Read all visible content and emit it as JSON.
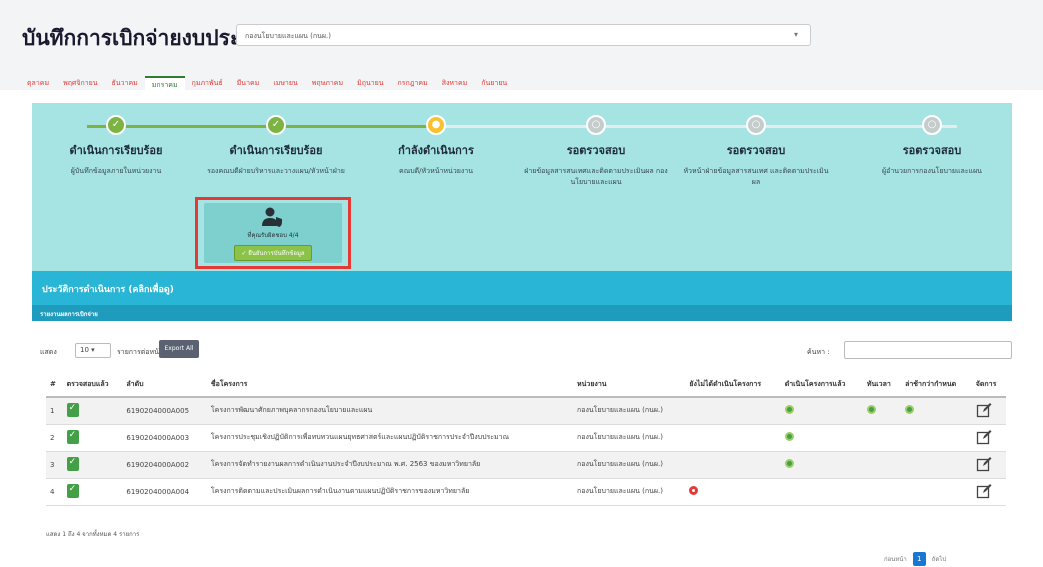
{
  "header": {
    "title": "บันทึกการเบิกจ่ายงบประมาณ",
    "department_select": "กองนโยบายและแผน (กนผ.)"
  },
  "tabs": [
    {
      "label": "ตุลาคม",
      "active": false
    },
    {
      "label": "พฤศจิกายน",
      "active": false
    },
    {
      "label": "ธันวาคม",
      "active": false
    },
    {
      "label": "มกราคม",
      "active": true
    },
    {
      "label": "กุมภาพันธ์",
      "active": false
    },
    {
      "label": "มีนาคม",
      "active": false
    },
    {
      "label": "เมษายน",
      "active": false
    },
    {
      "label": "พฤษภาคม",
      "active": false
    },
    {
      "label": "มิถุนายน",
      "active": false
    },
    {
      "label": "กรกฎาคม",
      "active": false
    },
    {
      "label": "สิงหาคม",
      "active": false
    },
    {
      "label": "กันยายน",
      "active": false
    }
  ],
  "steps": [
    {
      "title": "ดำเนินการเรียบร้อย",
      "desc": "ผู้บันทึกข้อมูลภายในหน่วยงาน",
      "status": "done"
    },
    {
      "title": "ดำเนินการเรียบร้อย",
      "desc": "รองคณบดีฝ่ายบริหารและวางแผน/หัวหน้าฝ่าย",
      "status": "done"
    },
    {
      "title": "กำลังดำเนินการ",
      "desc": "คณบดี/หัวหน้าหน่วยงาน",
      "status": "current"
    },
    {
      "title": "รอตรวจสอบ",
      "desc": "ฝ่ายข้อมูลสารสนเทศและติดตามประเมินผล กองนโยบายและแผน",
      "status": "pending"
    },
    {
      "title": "รอตรวจสอบ",
      "desc": "หัวหน้าฝ่ายข้อมูลสารสนเทศ และติดตามประเมินผล",
      "status": "pending"
    },
    {
      "title": "รอตรวจสอบ",
      "desc": "ผู้อำนวยการกองนโยบายและแผน",
      "status": "pending"
    }
  ],
  "current_action": {
    "who": "ที่คุณรับผิดชอบ 4/4",
    "button": "✓ ยืนยันการบันทึกข้อมูล"
  },
  "history": {
    "title": "ประวัติการดำเนินการ (คลิกเพื่อดู)",
    "subtitle": "รายงานผลการเบิกจ่าย"
  },
  "controls": {
    "show_label": "แสดง",
    "page_length": "10",
    "records_label": "รายการต่อหน้า",
    "export_label": "Export All",
    "search_label": "ค้นหา :"
  },
  "table": {
    "columns": [
      "#",
      "ตรวจสอบแล้ว",
      "ลำดับ",
      "ชื่อโครงการ",
      "หน่วยงาน",
      "ยังไม่ได้ดำเนินโครงการ",
      "ดำเนินโครงการแล้ว",
      "ทันเวลา",
      "ล่าช้ากว่ากำหนด",
      "จัดการ"
    ],
    "rows": [
      {
        "num": "1",
        "code": "6190204000A005",
        "name": "โครงการพัฒนาศักยภาพบุคลากรกองนโยบายและแผน",
        "unit": "กองนโยบายและแผน (กนผ.)",
        "not_started": false,
        "started": true,
        "on_time": true,
        "delayed": true
      },
      {
        "num": "2",
        "code": "6190204000A003",
        "name": "โครงการประชุมเชิงปฏิบัติการเพื่อทบทวนแผนยุทธศาสตร์และแผนปฏิบัติราชการประจำปีงบประมาณ",
        "unit": "กองนโยบายและแผน (กนผ.)",
        "not_started": false,
        "started": true,
        "on_time": false,
        "delayed": false
      },
      {
        "num": "3",
        "code": "6190204000A002",
        "name": "โครงการจัดทำรายงานผลการดำเนินงานประจำปีงบประมาณ พ.ศ. 2563 ของมหาวิทยาลัย",
        "unit": "กองนโยบายและแผน (กนผ.)",
        "not_started": false,
        "started": true,
        "on_time": false,
        "delayed": false
      },
      {
        "num": "4",
        "code": "6190204000A004",
        "name": "โครงการติดตามและประเมินผลการดำเนินงานตามแผนปฏิบัติราชการของมหาวิทยาลัย",
        "unit": "กองนโยบายและแผน (กนผ.)",
        "not_started": true,
        "started": false,
        "on_time": false,
        "delayed": false
      }
    ]
  },
  "footer": {
    "info": "แสดง 1 ถึง 4 จากทั้งหมด 4 รายการ",
    "prev": "ก่อนหน้า",
    "page": "1",
    "next": "ถัดไป"
  },
  "colors": {
    "panel": "#a6e4e4",
    "history_band": "#29b6d6",
    "done": "#7cb342",
    "current": "#fbc02d",
    "highlight_border": "#e53935"
  }
}
